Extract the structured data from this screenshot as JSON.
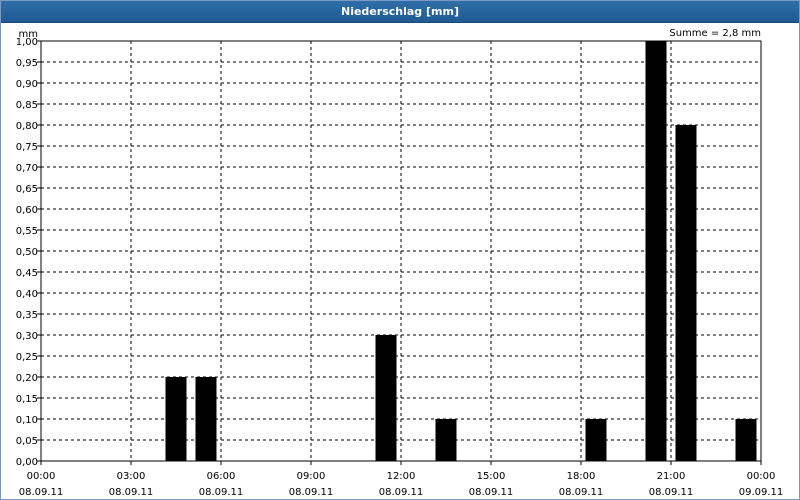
{
  "window": {
    "title": "Niederschlag [mm]",
    "sum_label": "Summe = 2,8 mm"
  },
  "chart_data": {
    "type": "bar",
    "title": "Niederschlag [mm]",
    "ylabel": "mm",
    "xlabel": "",
    "ylim": [
      0,
      1.0
    ],
    "ytick_step": 0.05,
    "y_tick_labels": [
      "0,00",
      "0,05",
      "0,10",
      "0,15",
      "0,20",
      "0,25",
      "0,30",
      "0,35",
      "0,40",
      "0,45",
      "0,50",
      "0,55",
      "0,60",
      "0,65",
      "0,70",
      "0,75",
      "0,80",
      "0,85",
      "0,90",
      "0,95",
      "1,00"
    ],
    "x_range_hours": [
      0,
      24
    ],
    "x_ticks": [
      {
        "hour": 0,
        "time": "00:00",
        "date": "08.09.11"
      },
      {
        "hour": 3,
        "time": "03:00",
        "date": "08.09.11"
      },
      {
        "hour": 6,
        "time": "06:00",
        "date": "08.09.11"
      },
      {
        "hour": 9,
        "time": "09:00",
        "date": "08.09.11"
      },
      {
        "hour": 12,
        "time": "12:00",
        "date": "08.09.11"
      },
      {
        "hour": 15,
        "time": "15:00",
        "date": "08.09.11"
      },
      {
        "hour": 18,
        "time": "18:00",
        "date": "08.09.11"
      },
      {
        "hour": 21,
        "time": "21:00",
        "date": "08.09.11"
      },
      {
        "hour": 24,
        "time": "00:00",
        "date": "09.09.11"
      }
    ],
    "bars": [
      {
        "hour": 5,
        "value": 0.2
      },
      {
        "hour": 6,
        "value": 0.2
      },
      {
        "hour": 12,
        "value": 0.3
      },
      {
        "hour": 14,
        "value": 0.1
      },
      {
        "hour": 19,
        "value": 0.1
      },
      {
        "hour": 21,
        "value": 1.0
      },
      {
        "hour": 22,
        "value": 0.8
      },
      {
        "hour": 24,
        "value": 0.1
      }
    ],
    "bar_color": "#000000",
    "grid": true,
    "total": 2.8
  }
}
